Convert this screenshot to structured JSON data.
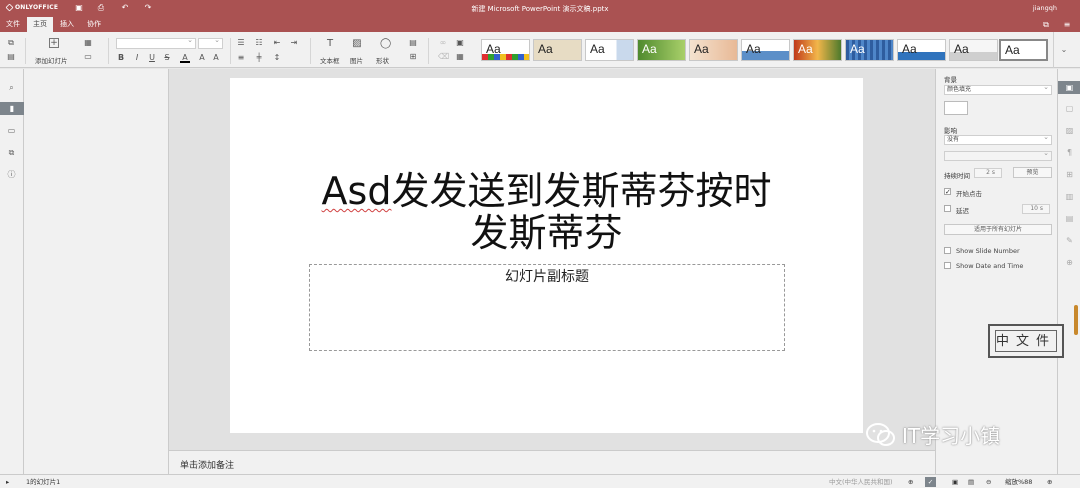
{
  "app": {
    "logo": "ONLYOFFICE",
    "doc_title": "新建 Microsoft PowerPoint 演示文稿.pptx",
    "user": "jiangqh"
  },
  "tabs": [
    {
      "label": "文件"
    },
    {
      "label": "主页"
    },
    {
      "label": "插入"
    },
    {
      "label": "协作"
    }
  ],
  "toolbar": {
    "add_slide_label": "添加幻灯片",
    "textbox_label": "文本框",
    "image_label": "图片",
    "shape_label": "形状",
    "theme_sample": "Aa",
    "theme_colors": [
      "#ffffff",
      "#ece3cd",
      "#e6edf5",
      "#6aa140",
      "#f1dcc4",
      "#8ab1d8",
      "#c7411e",
      "#3a66a6",
      "#2f6fb6",
      "#f4f4f4",
      "#ffffff"
    ]
  },
  "slide": {
    "title_word": "Asd",
    "title_line1_rest": "发发送到发斯蒂芬按时",
    "title_line2": "发斯蒂芬",
    "subtitle": "幻灯片副标题"
  },
  "notes": {
    "placeholder": "单击添加备注"
  },
  "right_panel": {
    "background_label": "背景",
    "background_fill": "颜色填充",
    "effect_label": "影响",
    "effect_value": "没有",
    "duration_label": "持续时间",
    "duration_value": "2 s",
    "preview_button": "预览",
    "start_on_click": "开始点击",
    "delay_label": "延迟",
    "delay_value": "10 s",
    "apply_all_button": "适用于所有幻灯片",
    "show_slide_number": "Show Slide Number",
    "show_date_time": "Show Date and Time"
  },
  "status": {
    "slide_counter": "1的幻灯片1",
    "language": "中文(中华人民共和国)",
    "zoom": "缩放%88"
  },
  "watermark": {
    "seal_text": "中文件",
    "channel": "IT学习小镇"
  }
}
